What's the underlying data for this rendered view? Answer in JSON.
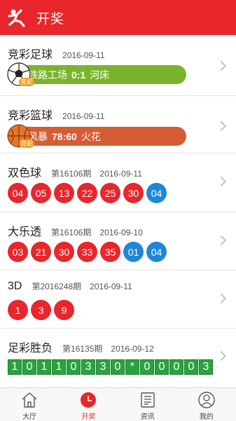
{
  "header": {
    "title": "开奖",
    "logo_icon": "running-man-logo-icon"
  },
  "colors": {
    "brand": "#e8262b",
    "red_ball": "#e8262b",
    "blue_ball": "#1e88d6",
    "football_bar": "#7ab42c",
    "basketball_bar": "#d55c33",
    "digit_bg": "#29a33e"
  },
  "rows": {
    "football": {
      "name": "竞彩足球",
      "date": "2016-09-11",
      "home": "铁路工场",
      "score": "0:1",
      "away": "河床",
      "tag": "竞彩"
    },
    "basketball": {
      "name": "竞彩篮球",
      "date": "2016-09-11",
      "home": "风暴",
      "score": "78:60",
      "away": "火花",
      "tag": "竞彩"
    },
    "ssq": {
      "name": "双色球",
      "issue": "第16106期",
      "date": "2016-09-11",
      "balls": [
        {
          "n": "04",
          "c": "red"
        },
        {
          "n": "05",
          "c": "red"
        },
        {
          "n": "13",
          "c": "red"
        },
        {
          "n": "22",
          "c": "red"
        },
        {
          "n": "25",
          "c": "red"
        },
        {
          "n": "30",
          "c": "red"
        },
        {
          "n": "04",
          "c": "blue"
        }
      ]
    },
    "dlt": {
      "name": "大乐透",
      "issue": "第16106期",
      "date": "2016-09-10",
      "balls": [
        {
          "n": "03",
          "c": "red"
        },
        {
          "n": "21",
          "c": "red"
        },
        {
          "n": "30",
          "c": "red"
        },
        {
          "n": "33",
          "c": "red"
        },
        {
          "n": "35",
          "c": "red"
        },
        {
          "n": "01",
          "c": "blue"
        },
        {
          "n": "04",
          "c": "blue"
        }
      ]
    },
    "fc3d": {
      "name": "3D",
      "issue": "第2016248期",
      "date": "2016-09-11",
      "balls": [
        {
          "n": "1",
          "c": "red"
        },
        {
          "n": "3",
          "c": "red"
        },
        {
          "n": "9",
          "c": "red"
        }
      ]
    },
    "sfc": {
      "name": "足彩胜负",
      "issue": "第16135期",
      "date": "2016-09-12",
      "digits": [
        "1",
        "0",
        "1",
        "1",
        "0",
        "3",
        "3",
        "0",
        "*",
        "0",
        "0",
        "0",
        "0",
        "3"
      ]
    }
  },
  "tabbar": [
    {
      "label": "大厅",
      "icon": "home-icon",
      "active": false
    },
    {
      "label": "开奖",
      "icon": "clock-icon",
      "active": true
    },
    {
      "label": "资讯",
      "icon": "news-icon",
      "active": false
    },
    {
      "label": "我的",
      "icon": "user-icon",
      "active": false
    }
  ]
}
